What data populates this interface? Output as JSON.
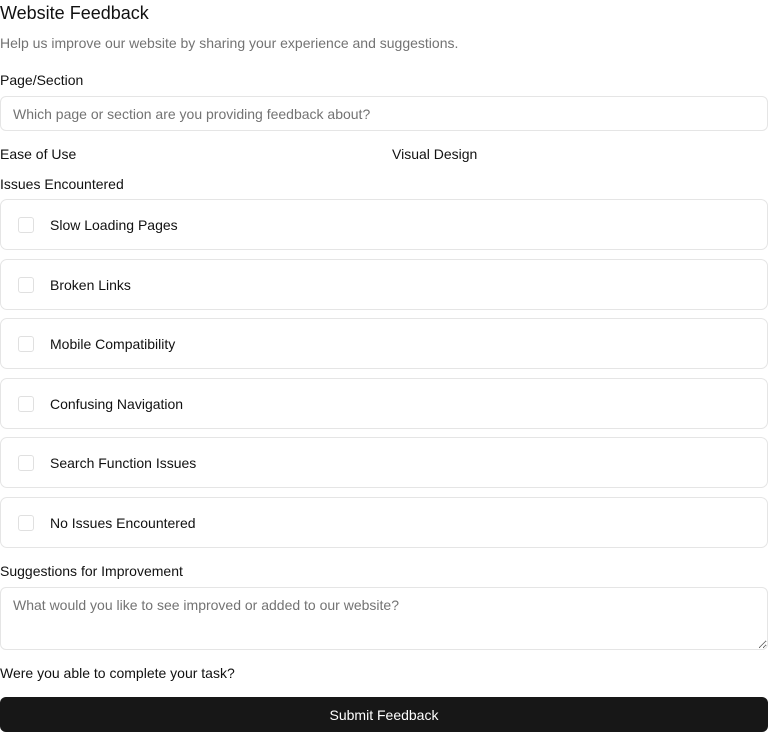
{
  "header": {
    "title": "Website Feedback",
    "subtitle": "Help us improve our website by sharing your experience and suggestions."
  },
  "page_section": {
    "label": "Page/Section",
    "placeholder": "Which page or section are you providing feedback about?",
    "value": ""
  },
  "ratings": {
    "ease_of_use_label": "Ease of Use",
    "visual_design_label": "Visual Design"
  },
  "issues": {
    "label": "Issues Encountered",
    "items": [
      {
        "label": "Slow Loading Pages",
        "checked": false
      },
      {
        "label": "Broken Links",
        "checked": false
      },
      {
        "label": "Mobile Compatibility",
        "checked": false
      },
      {
        "label": "Confusing Navigation",
        "checked": false
      },
      {
        "label": "Search Function Issues",
        "checked": false
      },
      {
        "label": "No Issues Encountered",
        "checked": false
      }
    ]
  },
  "suggestions": {
    "label": "Suggestions for Improvement",
    "placeholder": "What would you like to see improved or added to our website?",
    "value": ""
  },
  "task": {
    "question": "Were you able to complete your task?"
  },
  "submit": {
    "label": "Submit Feedback",
    "color": "#171717"
  }
}
